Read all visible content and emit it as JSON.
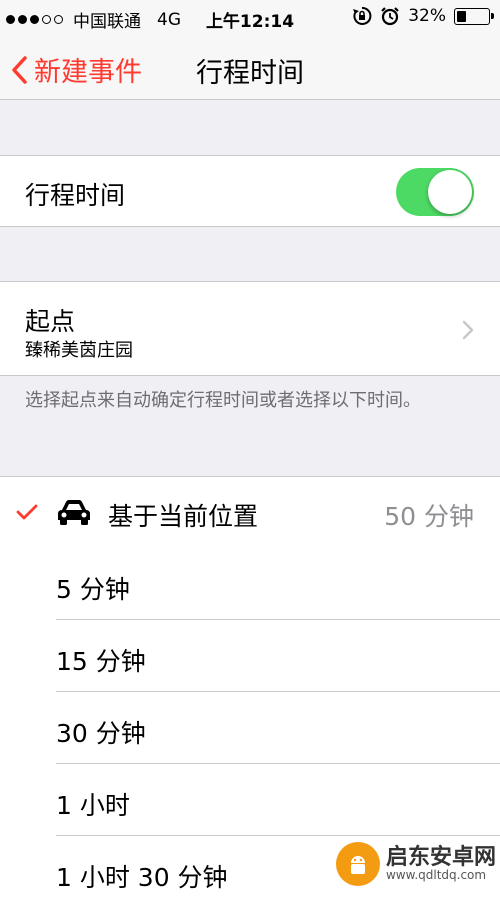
{
  "status_bar": {
    "carrier": "中国联通",
    "network": "4G",
    "time": "上午12:14",
    "battery": "32%",
    "battery_level": 0.32,
    "signal_strength": 3,
    "signal_max": 5
  },
  "nav": {
    "back_label": "新建事件",
    "title": "行程时间",
    "accent_color": "#ff3b30"
  },
  "toggle": {
    "label": "行程时间",
    "on": true,
    "color": "#4cd964"
  },
  "origin": {
    "label": "起点",
    "value": "臻稀美茵庄园"
  },
  "footnote": "选择起点来自动确定行程时间或者选择以下时间。",
  "current": {
    "label": "基于当前位置",
    "value": "50 分钟",
    "selected": true
  },
  "options": [
    "5 分钟",
    "15 分钟",
    "30 分钟",
    "1 小时",
    "1 小时 30 分钟"
  ],
  "watermark": {
    "name": "启东安卓网",
    "url": "www.qdltdq.com"
  }
}
